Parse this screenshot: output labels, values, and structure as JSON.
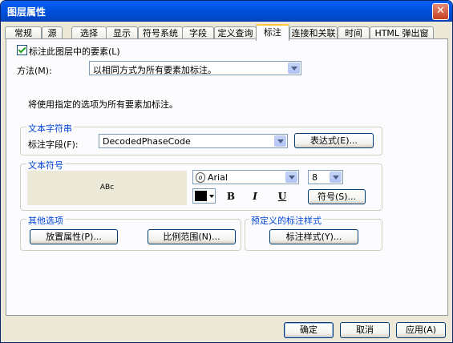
{
  "window": {
    "title": "图层属性",
    "close_glyph": "✕"
  },
  "tabs": [
    {
      "label": "常规"
    },
    {
      "label": "源"
    },
    {
      "label": "选择"
    },
    {
      "label": "显示"
    },
    {
      "label": "符号系统"
    },
    {
      "label": "字段"
    },
    {
      "label": "定义查询"
    },
    {
      "label": "标注",
      "active": true
    },
    {
      "label": "连接和关联"
    },
    {
      "label": "时间"
    },
    {
      "label": "HTML 弹出窗口"
    }
  ],
  "label_checkbox": {
    "label": "标注此图层中的要素(L)",
    "checked": true
  },
  "method": {
    "label": "方法(M):",
    "value": "以相同方式为所有要素加标注。"
  },
  "info_text": "将使用指定的选项为所有要素加标注。",
  "text_string": {
    "group_title": "文本字符串",
    "field_label": "标注字段(F):",
    "field_value": "DecodedPhaseCode",
    "expression_button": "表达式(E)..."
  },
  "text_symbol": {
    "group_title": "文本符号",
    "preview_text": "ABc",
    "font_icon": "opentype-font-icon",
    "font_name": "Arial",
    "font_size": "8",
    "color": "#000000",
    "bold": "B",
    "italic": "I",
    "underline": "U",
    "symbol_button": "符号(S)..."
  },
  "other_options": {
    "group_title": "其他选项",
    "placement_button": "放置属性(P)...",
    "scale_button": "比例范围(N)..."
  },
  "predefined": {
    "group_title": "预定义的标注样式",
    "style_button": "标注样式(Y)..."
  },
  "footer": {
    "ok": "确定",
    "cancel": "取消",
    "apply": "应用(A)"
  }
}
